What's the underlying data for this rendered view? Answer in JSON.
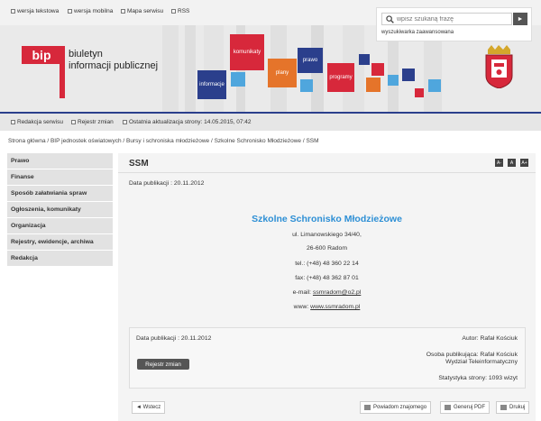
{
  "top_links": [
    {
      "label": "wersja tekstowa"
    },
    {
      "label": "wersja mobilna"
    },
    {
      "label": "Mapa serwisu"
    },
    {
      "label": "RSS"
    }
  ],
  "search": {
    "placeholder": "wpisz szukaną frazę",
    "button": "►",
    "advanced": "wyszukiwarka zaawansowana"
  },
  "banner": {
    "title_line1": "biuletyn",
    "title_line2": "informacji publicznej",
    "logo_text": "bip",
    "tiles": [
      "komunikaty",
      "prawo",
      "plany",
      "programy",
      "informacje"
    ]
  },
  "info_links": [
    {
      "label": "Redakcja serwisu"
    },
    {
      "label": "Rejestr zmian"
    },
    {
      "label": "Ostatnia aktualizacja strony: 14.05.2015, 07:42"
    }
  ],
  "breadcrumb": "Strona główna / BIP jednostek oświatowych / Bursy i schroniska młodzieżowe / Szkolne Schronisko Młodzieżowe / SSM",
  "sidebar": {
    "items": [
      {
        "label": "Prawo"
      },
      {
        "label": "Finanse"
      },
      {
        "label": "Sposób załatwiania spraw"
      },
      {
        "label": "Ogłoszenia, komunikaty"
      },
      {
        "label": "Organizacja"
      },
      {
        "label": "Rejestry, ewidencje, archiwa"
      },
      {
        "label": "Redakcja"
      }
    ]
  },
  "main": {
    "title": "SSM",
    "font_sizes": [
      "A-",
      "A",
      "A+"
    ],
    "pub_date": "Data publikacji : 20.11.2012",
    "org_name": "Szkolne Schronisko Młodzieżowe",
    "address1": "ul. Limanowskiego 34/40,",
    "address2": "26-600 Radom",
    "tel": "tel.: (+48) 48 360 22 14",
    "fax": "fax: (+48) 48 362 87 01",
    "email_label": "e-mail: ",
    "email": "ssmradom@o2.pl",
    "www_label": "www: ",
    "www": "www.ssmradom.pl"
  },
  "meta": {
    "pub_date": "Data publikacji : 20.11.2012",
    "author": "Autor: Rafał Kościuk",
    "publisher1": "Osoba publikująca: Rafał Kościuk",
    "publisher2": "Wydział Teleinformatyczny",
    "stats": "Statystyka strony: 1093 wizyt",
    "registry_button": "Rejestr zmian"
  },
  "footer": {
    "back": "◄ Wstecz",
    "recommend": "Powiadom znajomego",
    "pdf": "Generuj PDF",
    "print": "Drukuj"
  },
  "colors": {
    "accent_blue": "#2d8fd5",
    "bip_red": "#d7283b",
    "banner_bar": "#2b3f8c"
  }
}
